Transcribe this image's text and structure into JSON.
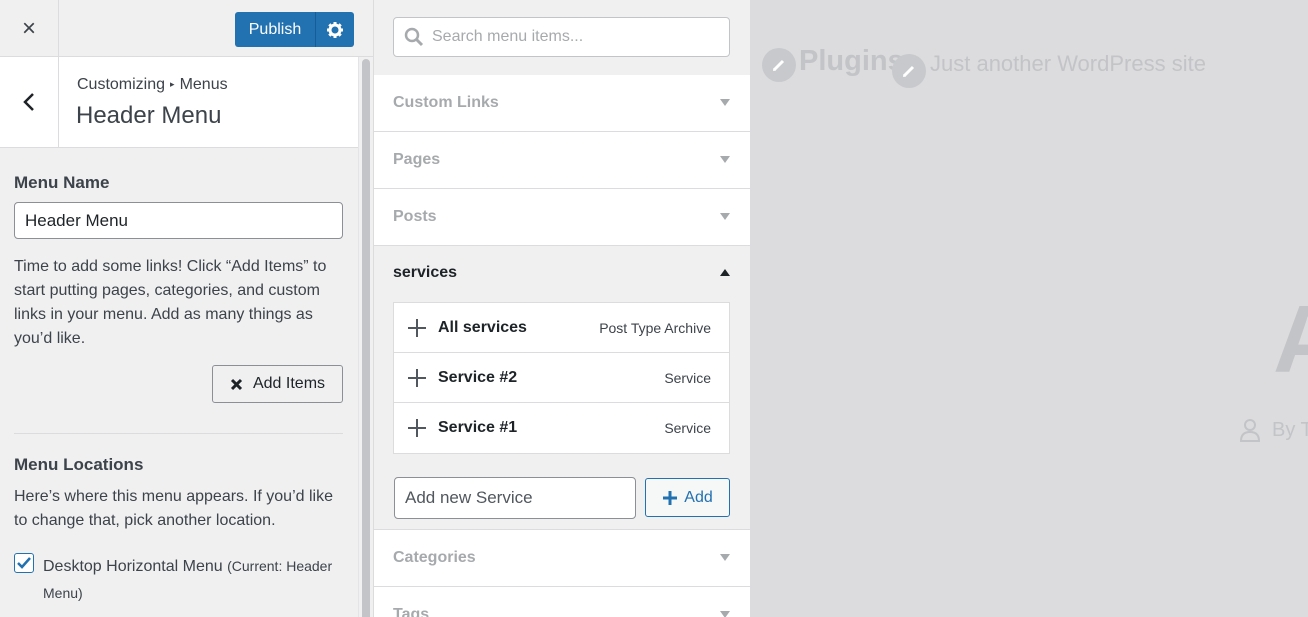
{
  "topbar": {
    "close_label": "×",
    "publish_label": "Publish"
  },
  "section": {
    "breadcrumb_parent": "Customizing",
    "breadcrumb_separator": "▸",
    "breadcrumb_child": "Menus",
    "title": "Header Menu"
  },
  "menu": {
    "name_label": "Menu Name",
    "name_value": "Header Menu",
    "description": "Time to add some links! Click “Add Items” to start putting pages, categories, and custom links in your menu. Add as many things as you’d like.",
    "add_items_label": "Add Items",
    "locations_label": "Menu Locations",
    "locations_description": "Here’s where this menu appears. If you’d like to change that, pick another location.",
    "location_name": "Desktop Horizontal Menu",
    "location_current": "(Current: Header Menu)",
    "location_checked": true
  },
  "items_panel": {
    "search_placeholder": "Search menu items...",
    "sections": [
      "Custom Links",
      "Pages",
      "Posts",
      "services",
      "Categories",
      "Tags"
    ],
    "services": [
      {
        "title": "All services",
        "type": "Post Type Archive"
      },
      {
        "title": "Service #2",
        "type": "Service"
      },
      {
        "title": "Service #1",
        "type": "Service"
      }
    ],
    "new_item_placeholder": "Add new Service",
    "add_label": "Add"
  },
  "preview": {
    "site_title": "Plugins",
    "tagline": "Just another WordPress site",
    "heading_fragment": "A",
    "byline": "By T"
  },
  "colors": {
    "accent": "#2271b1",
    "panel_bg": "#f0f0f1",
    "preview_text": "#c3c4c7"
  }
}
